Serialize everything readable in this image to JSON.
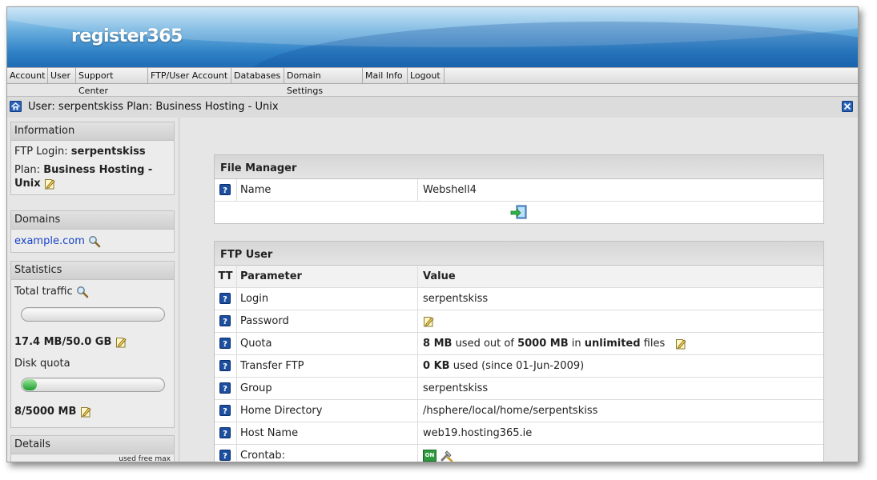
{
  "brand": {
    "logo": "register365"
  },
  "menu": [
    {
      "label": "Account"
    },
    {
      "label": "User"
    },
    {
      "label": "Support Center"
    },
    {
      "label": "FTP/User Account"
    },
    {
      "label": "Databases"
    },
    {
      "label": "Domain Settings"
    },
    {
      "label": "Mail Info"
    },
    {
      "label": "Logout"
    }
  ],
  "titlebar": {
    "text": "User: serpentskiss Plan: Business Hosting - Unix"
  },
  "sidebar": {
    "information": {
      "header": "Information",
      "ftp_login_label": "FTP Login:",
      "ftp_login_value": "serpentskiss",
      "plan_label": "Plan:",
      "plan_value_line1": "Business Hosting -",
      "plan_value_line2": "Unix"
    },
    "domains": {
      "header": "Domains",
      "domain": "example.com"
    },
    "statistics": {
      "header": "Statistics",
      "traffic_label": "Total traffic",
      "traffic_value": "17.4 MB/50.0 GB",
      "traffic_fraction": 0.0003,
      "disk_label": "Disk quota",
      "disk_value": "8/5000 MB",
      "disk_fraction": 0.0016
    },
    "details": {
      "header": "Details",
      "cols": "used free max"
    }
  },
  "file_manager": {
    "header": "File Manager",
    "name_label": "Name",
    "name_value": "Webshell4"
  },
  "ftp_user": {
    "header": "FTP User",
    "col_tt": "TT",
    "col_param": "Parameter",
    "col_value": "Value",
    "login_label": "Login",
    "login_value": "serpentskiss",
    "password_label": "Password",
    "quota_label": "Quota",
    "quota_used": "8 MB",
    "quota_text1": "used out of",
    "quota_total": "5000 MB",
    "quota_text2": "in",
    "quota_files": "unlimited",
    "quota_text3": "files",
    "transfer_label": "Transfer FTP",
    "transfer_value": "0 KB",
    "transfer_text": "used (since 01-Jun-2009)",
    "group_label": "Group",
    "group_value": "serpentskiss",
    "home_label": "Home Directory",
    "home_value": "/hsphere/local/home/serpentskiss",
    "host_label": "Host Name",
    "host_value": "web19.hosting365.ie",
    "crontab_label": "Crontab:",
    "crontab_badge": "ON"
  },
  "colors": {
    "banner": "#2f82c6",
    "link": "#1a44c8",
    "help_icon": "#1c4fa0",
    "progress": "#1e9c2e"
  }
}
